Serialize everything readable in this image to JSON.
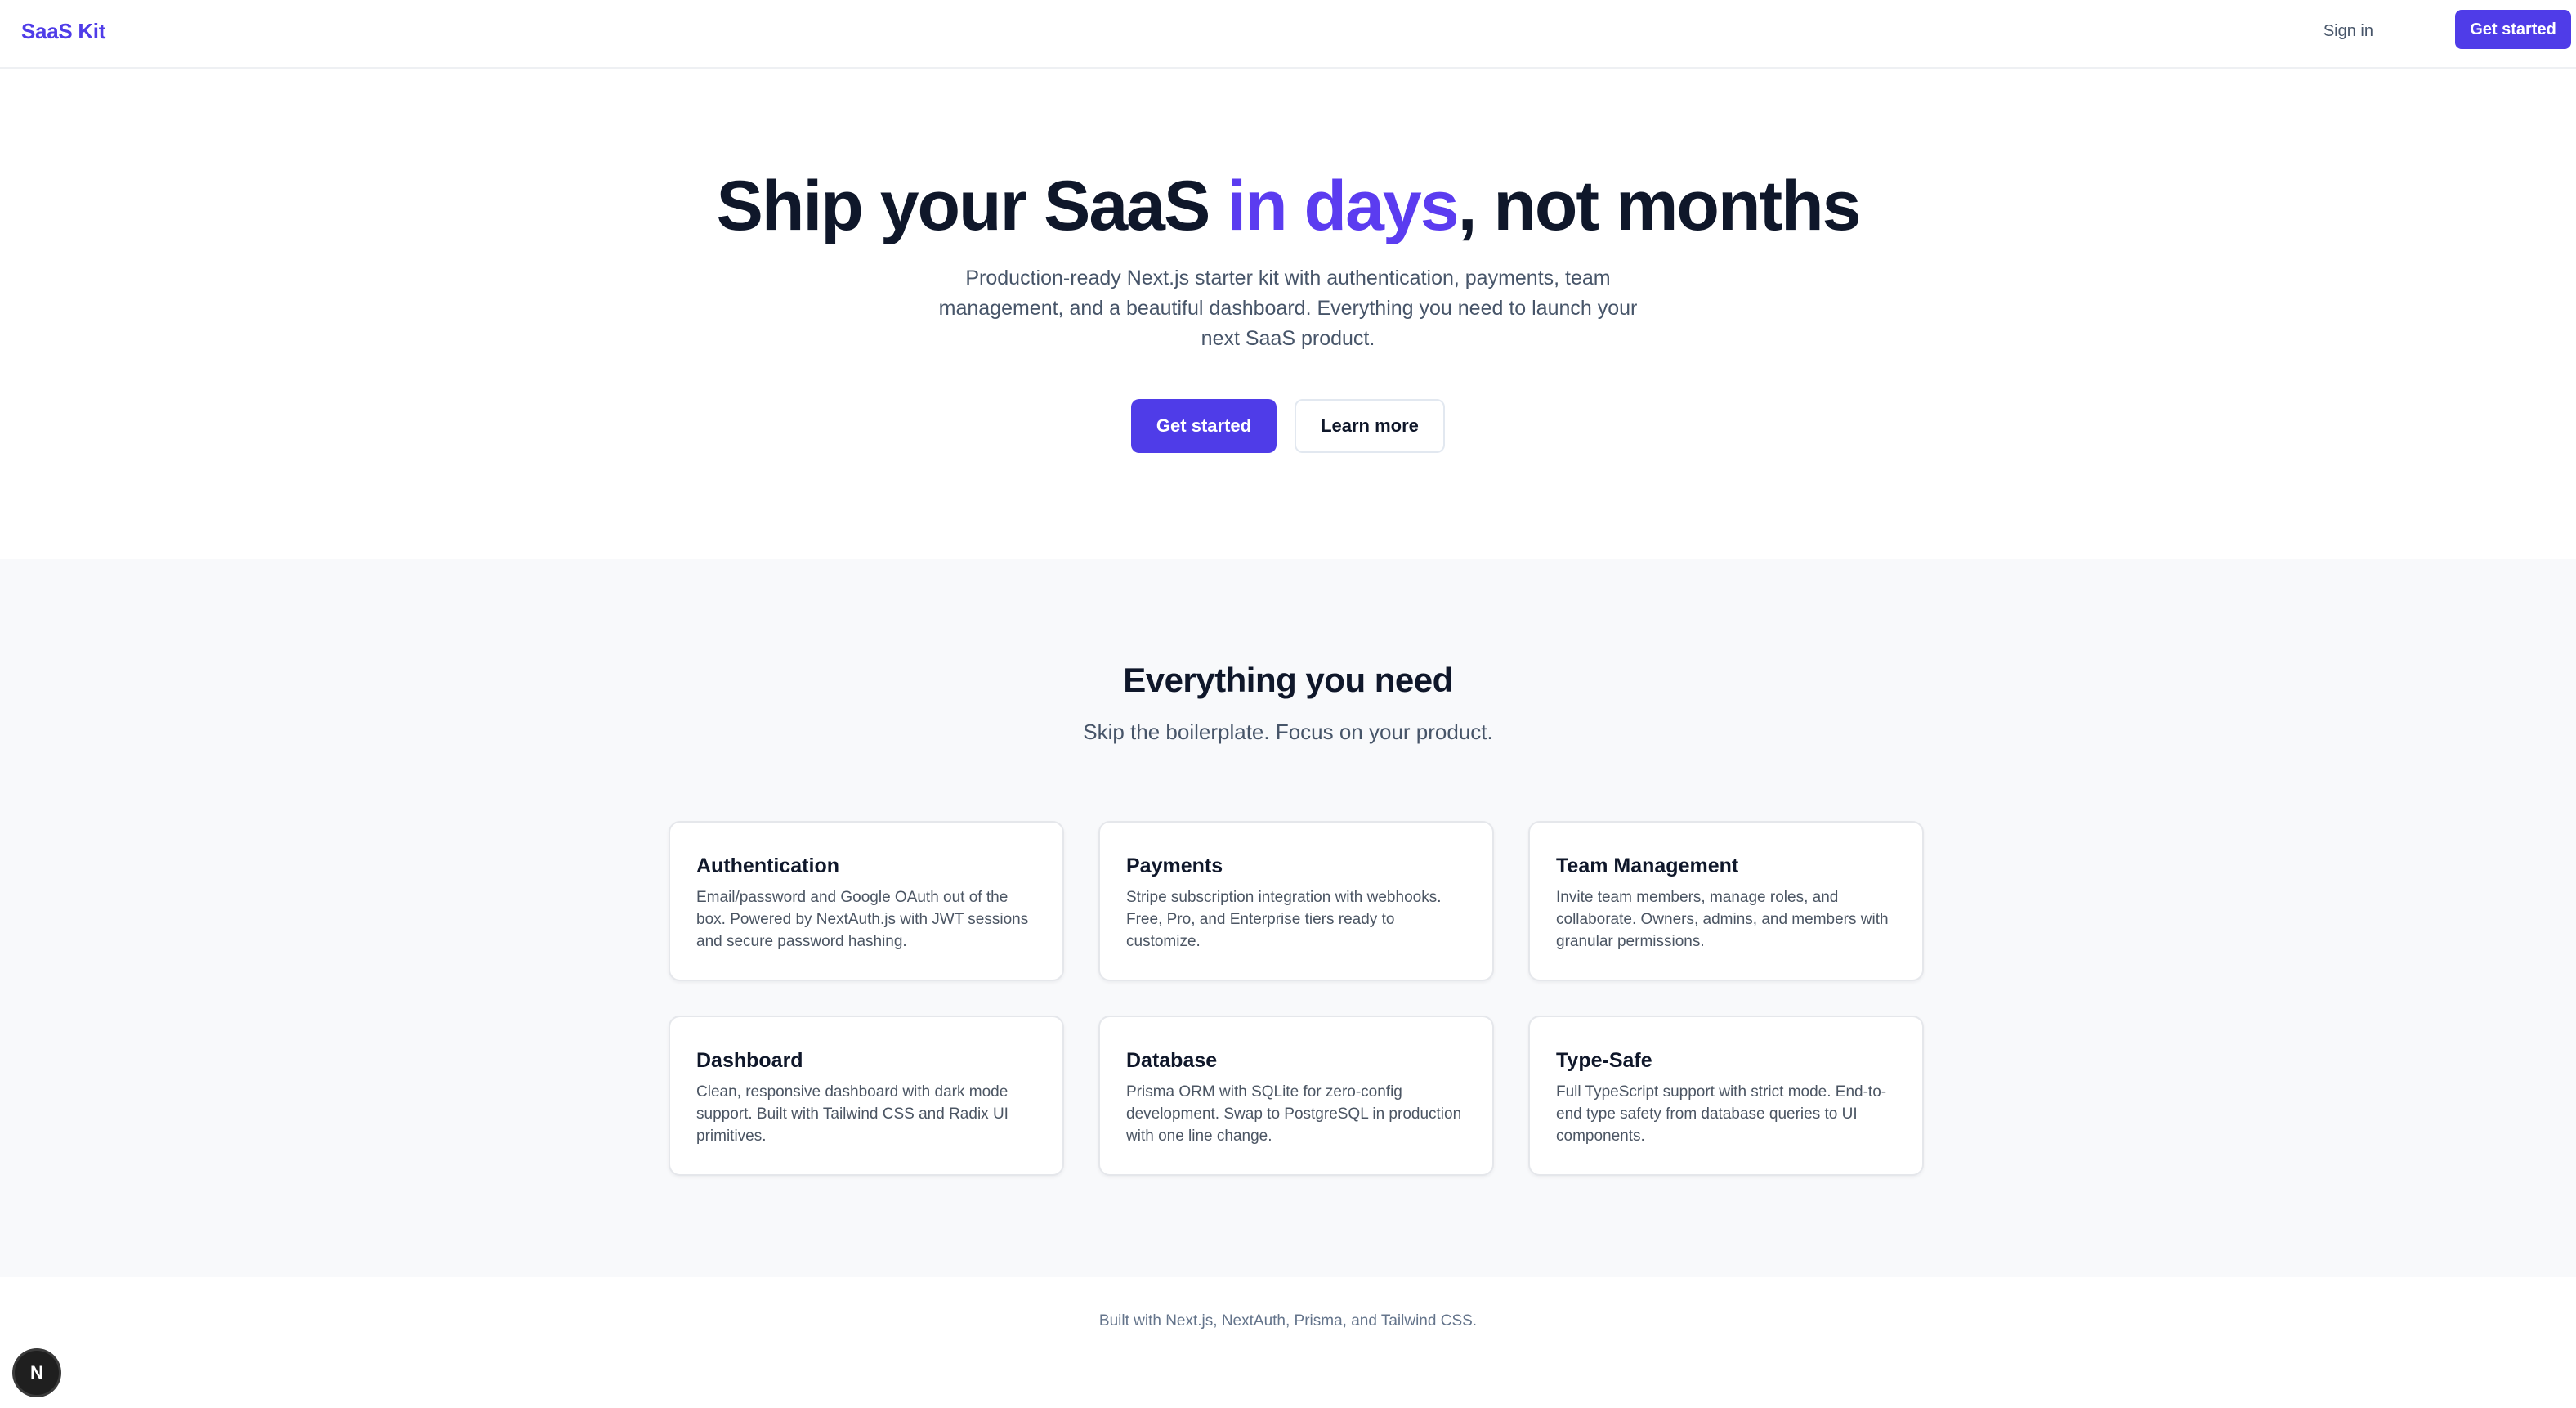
{
  "header": {
    "brand": "SaaS Kit",
    "signin_label": "Sign in",
    "cta_label": "Get started"
  },
  "hero": {
    "title_part1": "Ship your SaaS ",
    "title_accent": "in days",
    "title_part2": ", not months",
    "subtitle": "Production-ready Next.js starter kit with authentication, payments, team management, and a beautiful dashboard. Everything you need to launch your next SaaS product.",
    "primary_label": "Get started",
    "secondary_label": "Learn more"
  },
  "features": {
    "title": "Everything you need",
    "subtitle": "Skip the boilerplate. Focus on your product.",
    "items": [
      {
        "title": "Authentication",
        "desc": "Email/password and Google OAuth out of the box. Powered by NextAuth.js with JWT sessions and secure password hashing."
      },
      {
        "title": "Payments",
        "desc": "Stripe subscription integration with webhooks. Free, Pro, and Enterprise tiers ready to customize."
      },
      {
        "title": "Team Management",
        "desc": "Invite team members, manage roles, and collaborate. Owners, admins, and members with granular permissions."
      },
      {
        "title": "Dashboard",
        "desc": "Clean, responsive dashboard with dark mode support. Built with Tailwind CSS and Radix UI primitives."
      },
      {
        "title": "Database",
        "desc": "Prisma ORM with SQLite for zero-config development. Swap to PostgreSQL in production with one line change."
      },
      {
        "title": "Type-Safe",
        "desc": "Full TypeScript support with strict mode. End-to-end type safety from database queries to UI components."
      }
    ]
  },
  "footer": {
    "text": "Built with Next.js, NextAuth, Prisma, and Tailwind CSS."
  },
  "dev_badge": {
    "letter": "N"
  },
  "colors": {
    "accent": "#4f3ce8",
    "heading": "#0f172a",
    "muted": "#475569",
    "section_bg": "#f8f9fb"
  }
}
